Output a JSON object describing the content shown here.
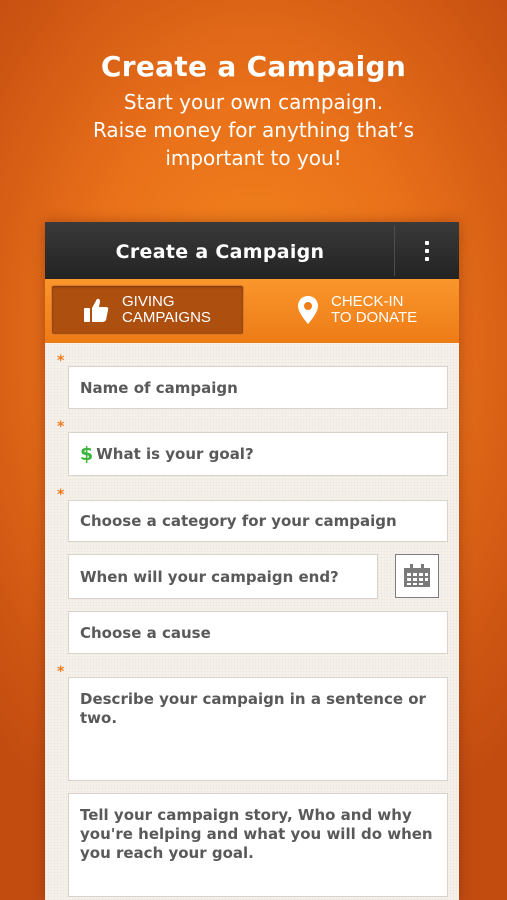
{
  "promo": {
    "title": "Create a Campaign",
    "line1": "Start your own campaign.",
    "line2": "Raise money for anything that’s",
    "line3": "important to you!"
  },
  "action_bar": {
    "title": "Create a Campaign",
    "overflow_icon": "overflow-menu-icon"
  },
  "tabs": [
    {
      "label": "GIVING\nCAMPAIGNS",
      "icon": "thumbs-up-icon",
      "active": true
    },
    {
      "label": "CHECK-IN\nTO DONATE",
      "icon": "location-pin-icon",
      "active": false
    }
  ],
  "form": {
    "required_marker": "*",
    "name_placeholder": "Name of campaign",
    "goal_prefix": "$",
    "goal_placeholder": "What is your goal?",
    "category_placeholder": "Choose a category for your campaign",
    "end_date_placeholder": "When will your campaign end?",
    "calendar_icon": "calendar-icon",
    "cause_placeholder": "Choose a cause",
    "description_placeholder": "Describe your campaign in a sentence or two.",
    "story_placeholder": "Tell your campaign story, Who and why you're helping and what you will do when you reach your goal."
  },
  "colors": {
    "accent": "#f08a24",
    "action_bar": "#2b2b2b",
    "active_tab": "#ac4f0f",
    "required": "#f07a1c",
    "dollar": "#3bb53b"
  }
}
